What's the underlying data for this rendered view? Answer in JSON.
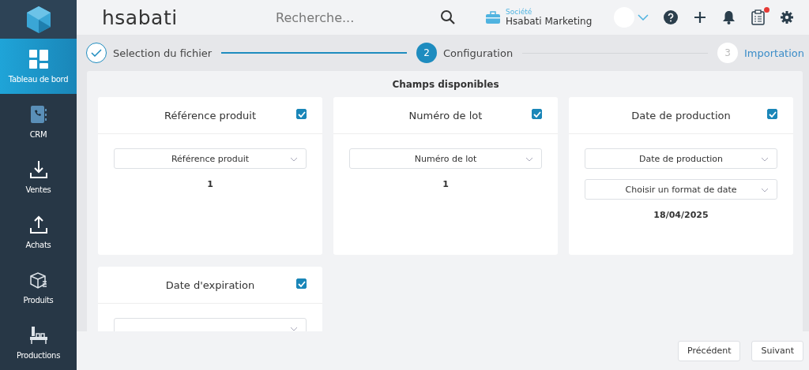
{
  "sidebar": {
    "items": [
      {
        "label": "Tableau de bord",
        "selected": true
      },
      {
        "label": "CRM",
        "selected": false
      },
      {
        "label": "Ventes",
        "selected": false
      },
      {
        "label": "Achats",
        "selected": false
      },
      {
        "label": "Produits",
        "selected": false
      },
      {
        "label": "Productions",
        "selected": false
      }
    ]
  },
  "header": {
    "brand": "hsabati",
    "search": {
      "placeholder": "Recherche..."
    },
    "company": {
      "caption": "Société",
      "name": "Hsabati Marketing"
    },
    "notification_dot": true
  },
  "stepper": {
    "steps": [
      {
        "label": "Selection du fichier",
        "completed": true,
        "selected": false
      },
      {
        "number": "2",
        "label": "Configuration",
        "completed": false,
        "selected": true
      },
      {
        "number": "3",
        "label": "Importation",
        "completed": false,
        "selected": false
      }
    ]
  },
  "fields_panel": {
    "title": "Champs disponibles",
    "cards": [
      {
        "title": "Référence produit",
        "checked": true,
        "selects": [
          "Référence produit"
        ],
        "preview": "1"
      },
      {
        "title": "Numéro de lot",
        "checked": true,
        "selects": [
          "Numéro de lot"
        ],
        "preview": "1"
      },
      {
        "title": "Date de production",
        "checked": true,
        "selects": [
          "Date de production",
          "Choisir un format de date"
        ],
        "preview": "18/04/2025"
      },
      {
        "title": "Date d'expiration",
        "checked": true,
        "cut_off": true
      }
    ]
  },
  "footer": {
    "buttons": [
      "Précédent",
      "Suivant"
    ]
  }
}
